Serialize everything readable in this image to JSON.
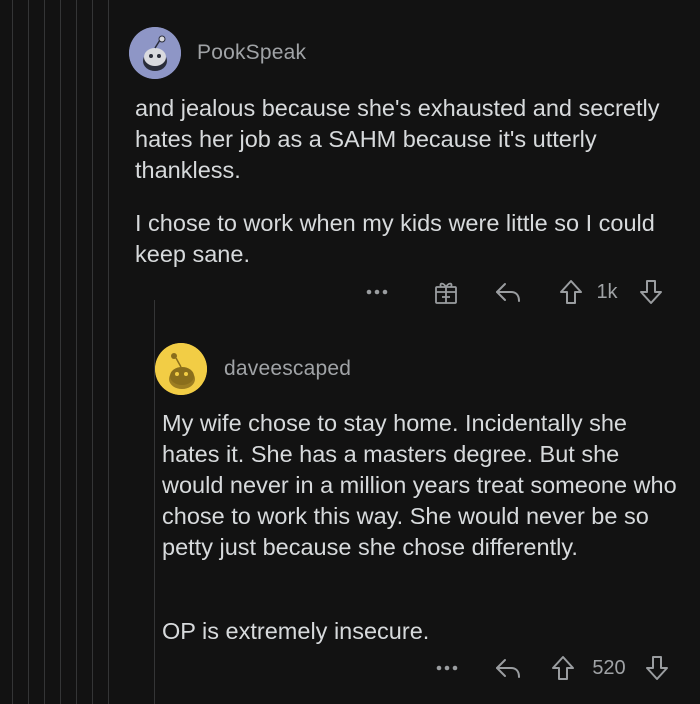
{
  "comments": [
    {
      "username": "PookSpeak",
      "avatar_color": "#8e96c6",
      "paragraphs": [
        "and jealous because she's exhausted and secretly hates her job as a SAHM because it's utterly thankless.",
        "I chose to work when my kids were little so I could keep sane."
      ],
      "score": "1k",
      "icons": [
        "more-icon",
        "gift-icon",
        "reply-icon",
        "upvote-icon",
        "downvote-icon"
      ]
    },
    {
      "username": "daveescaped",
      "avatar_color": "#f2cd45",
      "paragraphs": [
        "My wife chose to stay home. Incidentally she hates it. She has a masters degree. But she would never in a million years treat someone who chose to work this way. She would never be so petty just because she chose differently.",
        "OP is extremely insecure."
      ],
      "score": "520",
      "icons": [
        "more-icon",
        "reply-icon",
        "upvote-icon",
        "downvote-icon"
      ]
    }
  ],
  "colors": {
    "background": "#121212",
    "text": "#d7dadc",
    "muted": "#a0a3a6",
    "thread_line": "#343536"
  }
}
